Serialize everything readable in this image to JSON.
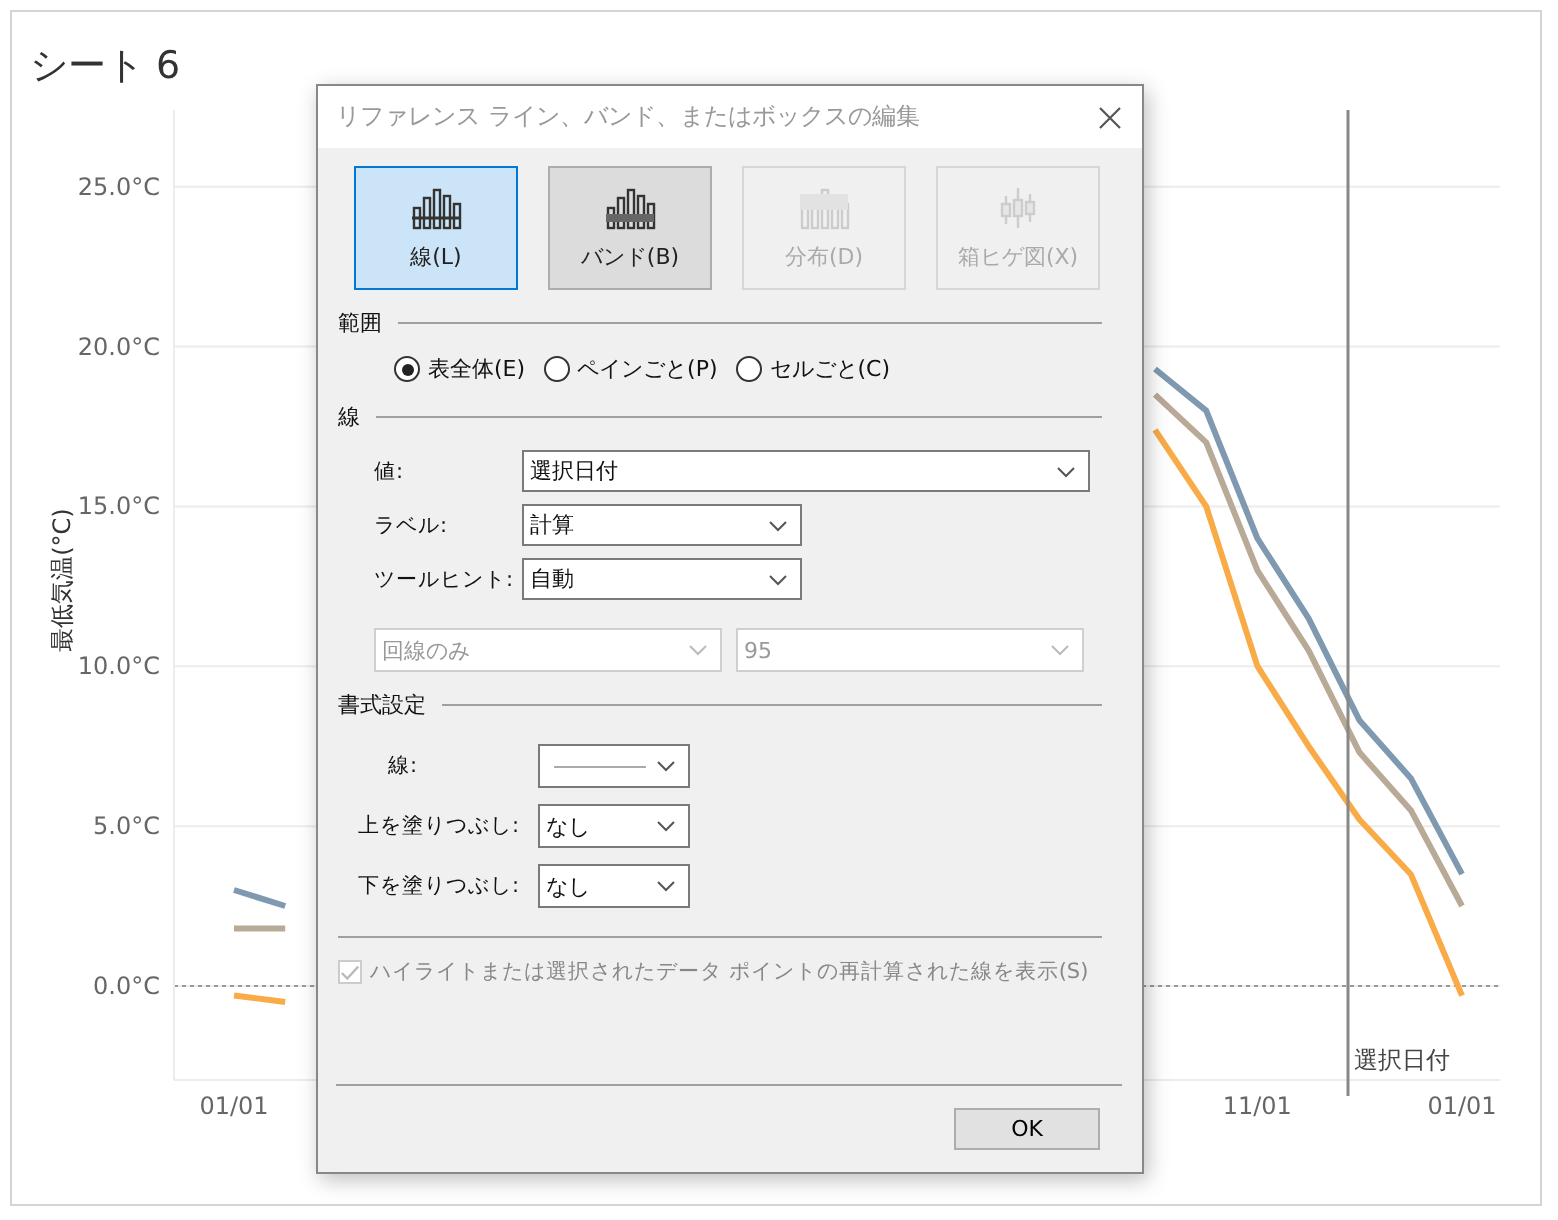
{
  "sheet": {
    "title": "シート 6"
  },
  "chart": {
    "reference_line": {
      "label": "選択日付"
    },
    "chart_data": {
      "type": "line",
      "ylabel": "最低気温(°C)",
      "ylim": [
        -2.94,
        27.4
      ],
      "grid": true,
      "ref_lines": [
        {
          "axis": "y",
          "value": 0
        }
      ],
      "categories": [
        "01/01",
        null,
        null,
        null,
        null,
        null,
        null,
        null,
        null,
        null,
        null,
        null,
        null,
        null,
        null,
        null,
        null,
        null,
        null,
        null,
        "11/01",
        null,
        null,
        null,
        "01/01"
      ],
      "yticks": [
        {
          "value": 25,
          "label": "25.0°C"
        },
        {
          "value": 20,
          "label": "20.0°C"
        },
        {
          "value": 15,
          "label": "15.0°C"
        },
        {
          "value": 10,
          "label": "10.0°C"
        },
        {
          "value": 5,
          "label": "5.0°C"
        },
        {
          "value": 0,
          "label": "0.0°C"
        }
      ],
      "series": [
        {
          "color": "#7f99b1",
          "values": [
            3.0,
            2.5,
            null,
            null,
            null,
            null,
            null,
            null,
            null,
            null,
            null,
            null,
            null,
            null,
            null,
            null,
            null,
            null,
            19.3,
            18.0,
            14.0,
            11.5,
            8.3,
            6.5,
            3.5
          ]
        },
        {
          "color": "#b9a997",
          "values": [
            1.8,
            1.8,
            null,
            null,
            null,
            null,
            null,
            null,
            null,
            null,
            null,
            null,
            null,
            null,
            null,
            null,
            null,
            null,
            18.5,
            17.0,
            13.0,
            10.5,
            7.3,
            5.5,
            2.5
          ]
        },
        {
          "color": "#f9ab48",
          "values": [
            -0.3,
            -0.5,
            null,
            null,
            null,
            null,
            null,
            null,
            null,
            null,
            null,
            null,
            null,
            null,
            null,
            null,
            null,
            null,
            17.4,
            15.0,
            10.0,
            7.5,
            5.2,
            3.5,
            -0.3
          ]
        }
      ]
    }
  },
  "dialog": {
    "title": "リファレンス ライン、バンド、またはボックスの編集",
    "type_buttons": [
      {
        "label": "線(L)",
        "kind": "line",
        "selected": true,
        "hovered": false,
        "disabled": false
      },
      {
        "label": "バンド(B)",
        "kind": "band",
        "selected": false,
        "hovered": true,
        "disabled": false
      },
      {
        "label": "分布(D)",
        "kind": "distribution",
        "selected": false,
        "hovered": false,
        "disabled": true
      },
      {
        "label": "箱ヒゲ図(X)",
        "kind": "box",
        "selected": false,
        "hovered": false,
        "disabled": true
      }
    ],
    "scope": {
      "heading": "範囲",
      "options": [
        {
          "label": "表全体(E)",
          "selected": true
        },
        {
          "label": "ペインごと(P)",
          "selected": false
        },
        {
          "label": "セルごと(C)",
          "selected": false
        }
      ]
    },
    "line": {
      "heading": "線",
      "fields": [
        {
          "label": "値:",
          "value": "選択日付",
          "kind": "wide"
        },
        {
          "label": "ラベル:",
          "value": "計算",
          "kind": "short"
        },
        {
          "label": "ツールヒント:",
          "value": "自動",
          "kind": "short"
        }
      ],
      "extra_selects": [
        {
          "value": "回線のみ",
          "disabled": true
        },
        {
          "value": "95",
          "disabled": true
        }
      ]
    },
    "format": {
      "heading": "書式設定",
      "fields": [
        {
          "label": "線:",
          "kind": "line-style"
        },
        {
          "label": "上を塗りつぶし:",
          "value": "なし",
          "kind": "text"
        },
        {
          "label": "下を塗りつぶし:",
          "value": "なし",
          "kind": "text"
        }
      ]
    },
    "highlight_option": {
      "label": "ハイライトまたは選択されたデータ ポイントの再計算された線を表示(S)",
      "checked": true,
      "disabled": true
    },
    "ok_button": "OK"
  }
}
